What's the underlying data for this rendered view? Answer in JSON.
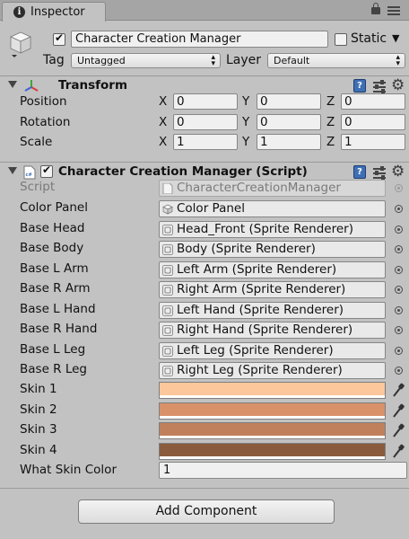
{
  "tab": {
    "title": "Inspector",
    "icon": "info-icon"
  },
  "header": {
    "object_name": "Character Creation Manager",
    "active": true,
    "static_label": "Static",
    "static_checked": false,
    "tag_label": "Tag",
    "tag_value": "Untagged",
    "layer_label": "Layer",
    "layer_value": "Default"
  },
  "transform": {
    "title": "Transform",
    "rows": [
      {
        "label": "Position",
        "x": "0",
        "y": "0",
        "z": "0"
      },
      {
        "label": "Rotation",
        "x": "0",
        "y": "0",
        "z": "0"
      },
      {
        "label": "Scale",
        "x": "1",
        "y": "1",
        "z": "1"
      }
    ],
    "axis_labels": {
      "x": "X",
      "y": "Y",
      "z": "Z"
    }
  },
  "script_component": {
    "title": "Character Creation Manager (Script)",
    "script_label": "Script",
    "script_value": "CharacterCreationManager",
    "fields": [
      {
        "label": "Color Panel",
        "value": "Color Panel",
        "icon": "gameobject-icon"
      },
      {
        "label": "Base Head",
        "value": "Head_Front (Sprite Renderer)",
        "icon": "sprite-renderer-icon"
      },
      {
        "label": "Base Body",
        "value": "Body (Sprite Renderer)",
        "icon": "sprite-renderer-icon"
      },
      {
        "label": "Base L Arm",
        "value": "Left Arm (Sprite Renderer)",
        "icon": "sprite-renderer-icon"
      },
      {
        "label": "Base R Arm",
        "value": "Right Arm (Sprite Renderer)",
        "icon": "sprite-renderer-icon"
      },
      {
        "label": "Base L Hand",
        "value": "Left Hand (Sprite Renderer)",
        "icon": "sprite-renderer-icon"
      },
      {
        "label": "Base R Hand",
        "value": "Right Hand (Sprite Renderer)",
        "icon": "sprite-renderer-icon"
      },
      {
        "label": "Base L Leg",
        "value": "Left Leg (Sprite Renderer)",
        "icon": "sprite-renderer-icon"
      },
      {
        "label": "Base R Leg",
        "value": "Right Leg (Sprite Renderer)",
        "icon": "sprite-renderer-icon"
      }
    ],
    "skins": [
      {
        "label": "Skin 1",
        "color": "#fbc79b"
      },
      {
        "label": "Skin 2",
        "color": "#d9916a"
      },
      {
        "label": "Skin 3",
        "color": "#c0805c"
      },
      {
        "label": "Skin 4",
        "color": "#8b5b3d"
      }
    ],
    "skin_color_label": "What Skin Color",
    "skin_color_value": "1"
  },
  "add_component_label": "Add Component"
}
